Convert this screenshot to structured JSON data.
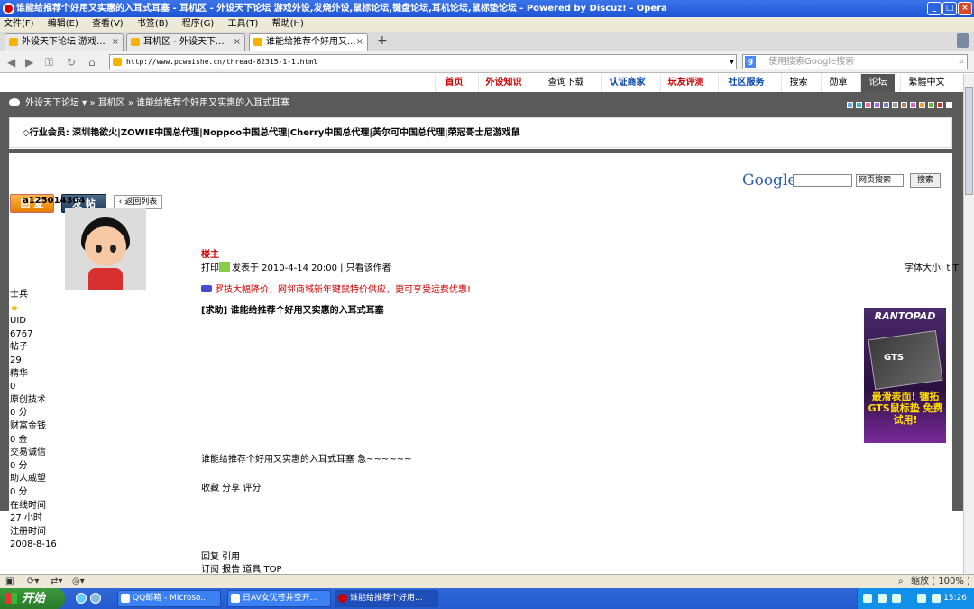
{
  "window": {
    "title": "谁能给推荐个好用又实惠的入耳式耳塞 - 耳机区 - 外设天下论坛 游戏外设,发烧外设,鼠标论坛,键盘论坛,耳机论坛,鼠标垫论坛 - Powered by Discuz! - Opera"
  },
  "menu": [
    "文件(F)",
    "编辑(E)",
    "查看(V)",
    "书签(B)",
    "程序(G)",
    "工具(T)",
    "帮助(H)"
  ],
  "tabs": [
    {
      "label": "外设天下论坛 游戏..."
    },
    {
      "label": "耳机区 - 外设天下..."
    },
    {
      "label": "谁能给推荐个好用又..."
    }
  ],
  "address": {
    "url": "http://www.pcwaishe.cn/thread-82315-1-1.html"
  },
  "search": {
    "placeholder": "使用搜索Google搜索"
  },
  "topnav": [
    "首页",
    "外设知识",
    "查询下载",
    "认证商家",
    "玩友评测",
    "社区服务",
    "搜索",
    "勋章",
    "论坛",
    "繁體中文"
  ],
  "breadcrumb": {
    "home": "外设天下论坛",
    "section": "» 耳机区 »",
    "thread": "谁能给推荐个好用又实惠的入耳式耳塞"
  },
  "swatch_colors": [
    "#66aaff",
    "#33bbcc",
    "#ff66aa",
    "#aa66ff",
    "#6688cc",
    "#999999",
    "#aa8866",
    "#cc66cc",
    "#ff9933",
    "#66bb33",
    "#cc3333",
    "#ffffff"
  ],
  "notice": "◇行业会员: 深圳艳欲火|ZOWIE中国总代理|Noppoo中国总代理|Cherry中国总代理|芙尔可中国总代理|荣冠哥士尼游戏鼠",
  "google": {
    "logo": "Google",
    "select": "网页搜索",
    "button": "搜索"
  },
  "buttons": {
    "reply": "回 复",
    "post": "发 帖",
    "back": "返回列表"
  },
  "author": {
    "name": "a125014304",
    "stats": [
      "士兵",
      "★",
      "UID",
      "6767",
      "帖子",
      "29",
      "精华",
      "0",
      "原创技术",
      "0 分",
      "财富金钱",
      "0 金",
      "交易诚信",
      "0 分",
      "助人威望",
      "0 分",
      "在线时间",
      "27 小时",
      "注册时间",
      "2008-8-16"
    ]
  },
  "post": {
    "role": "楼主",
    "print": "打印",
    "meta": "发表于 2010-4-14 20:00 | 只看该作者",
    "fontsize": "字体大小: t T",
    "ad": "罗技大幅降价，网邻商城新年键鼠特价供应，更可享受运费优惠!",
    "title": "[求助] 谁能给推荐个好用又实惠的入耳式耳塞",
    "body": "谁能给推荐个好用又实惠的入耳式耳塞 急~~~~~~",
    "actions": "收藏 分享 评分",
    "reply_line": "回复 引用",
    "sub_line": "订阅 报告 道具 TOP"
  },
  "banner": {
    "brand": "RANTOPAD",
    "product": "GTS",
    "slogan": "最滑表面! 镭拓GTS鼠标垫 免费试用!"
  },
  "status": {
    "zoom": "缩放 ( 100% )"
  },
  "taskbar": {
    "start": "开始",
    "items": [
      "QQ邮箱 - Microso...",
      "日AV女优苍井空开...",
      "谁能给推荐个好用..."
    ],
    "time": "15:26"
  }
}
